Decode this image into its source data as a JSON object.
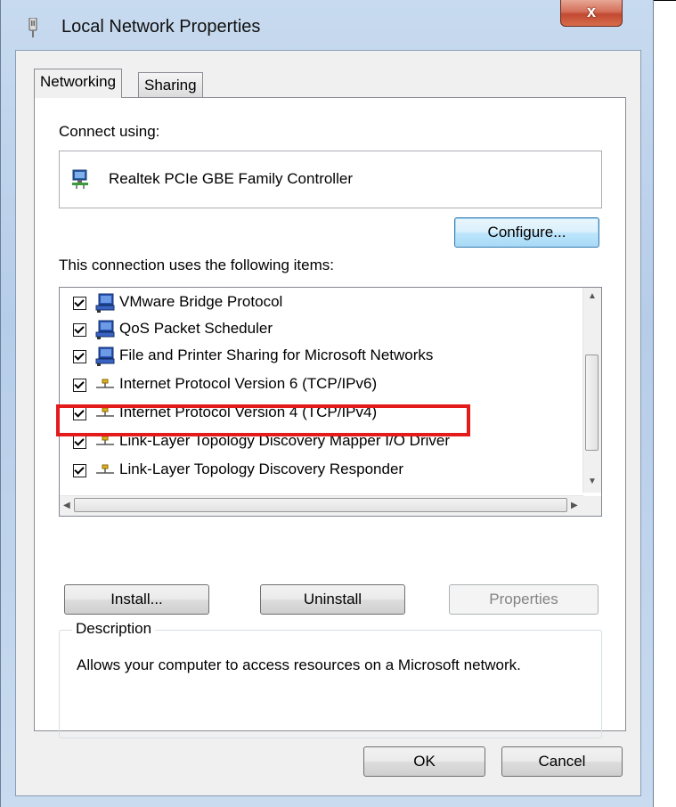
{
  "window": {
    "title": "Local Network Properties",
    "close_label": "x"
  },
  "tabs": [
    {
      "label": "Networking",
      "active": true
    },
    {
      "label": "Sharing",
      "active": false
    }
  ],
  "connect_using": {
    "label": "Connect using:",
    "adapter": "Realtek PCIe GBE Family Controller",
    "configure_button": "Configure..."
  },
  "items_section": {
    "label": "This connection uses the following items:",
    "items": [
      {
        "label": "VMware Bridge Protocol",
        "checked": true,
        "icon": "network-client-icon"
      },
      {
        "label": "QoS Packet Scheduler",
        "checked": true,
        "icon": "network-client-icon"
      },
      {
        "label": "File and Printer Sharing for Microsoft Networks",
        "checked": true,
        "icon": "network-client-icon"
      },
      {
        "label": "Internet Protocol Version 6 (TCP/IPv6)",
        "checked": true,
        "icon": "protocol-icon"
      },
      {
        "label": "Internet Protocol Version 4 (TCP/IPv4)",
        "checked": true,
        "icon": "protocol-icon"
      },
      {
        "label": "Link-Layer Topology Discovery Mapper I/O Driver",
        "checked": true,
        "icon": "protocol-icon"
      },
      {
        "label": "Link-Layer Topology Discovery Responder",
        "checked": true,
        "icon": "protocol-icon"
      }
    ]
  },
  "buttons": {
    "install": "Install...",
    "uninstall": "Uninstall",
    "properties": "Properties",
    "ok": "OK",
    "cancel": "Cancel"
  },
  "description": {
    "legend": "Description",
    "text": "Allows your computer to access resources on a Microsoft network."
  },
  "colors": {
    "highlight": "#e41b1b",
    "close_button": "#c24a32"
  }
}
